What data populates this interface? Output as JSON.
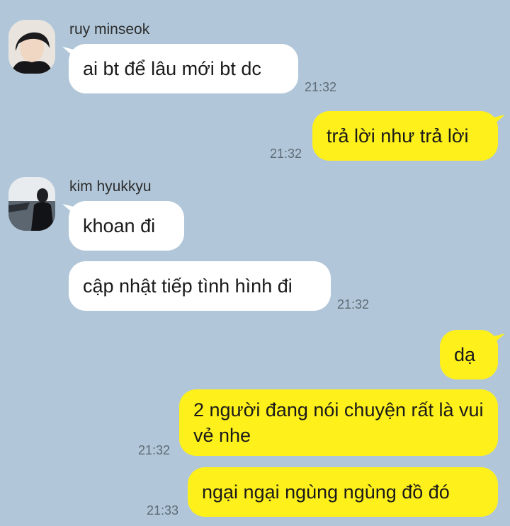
{
  "chat": {
    "colors": {
      "background": "#b1c7d9",
      "incoming_bubble": "#ffffff",
      "outgoing_bubble": "#fef01b",
      "timestamp": "#5e6b76"
    },
    "messages": [
      {
        "sender": "ruy minseok",
        "avatar": "avatar-photo-dark-hair",
        "direction": "in",
        "text": "ai bt để lâu mới bt dc",
        "time": "21:32"
      },
      {
        "direction": "out",
        "text": "trả lời như trả lời",
        "time": "21:32"
      },
      {
        "sender": "kim hyukkyu",
        "avatar": "avatar-photo-waterside",
        "direction": "in",
        "text": "khoan đi",
        "time": ""
      },
      {
        "direction": "in",
        "text": "cập nhật tiếp tình hình đi",
        "time": "21:32"
      },
      {
        "direction": "out",
        "text": "dạ",
        "time": ""
      },
      {
        "direction": "out",
        "text": "2 người đang nói chuyện rất là vui vẻ nhe",
        "time": "21:32"
      },
      {
        "direction": "out",
        "text": "ngại ngại ngùng ngùng đồ đó",
        "time": "21:33"
      }
    ]
  }
}
